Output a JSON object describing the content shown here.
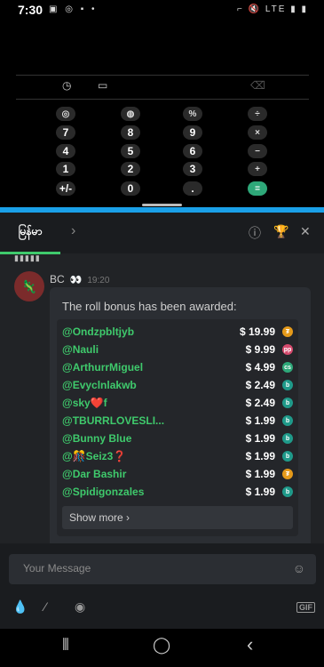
{
  "status": {
    "time": "7:30",
    "left_icons": "▣ ◎ ▪ •",
    "right_icons": "⌐ 🔇 LTE ▮ ▮"
  },
  "calculator": {
    "toolbar": {
      "history": "◷",
      "ruler": "▭",
      "backspace": "⌫"
    },
    "keys": [
      [
        "◎",
        "◍",
        "%",
        "÷"
      ],
      [
        "7",
        "8",
        "9",
        "×"
      ],
      [
        "4",
        "5",
        "6",
        "−"
      ],
      [
        "1",
        "2",
        "3",
        "+"
      ],
      [
        "+/-",
        "0",
        ".",
        "="
      ]
    ]
  },
  "app": {
    "tab_label": "မြန်မာ",
    "chevron": "›",
    "icons": {
      "info": "ⓘ",
      "trophy": "🏆",
      "close": "✕"
    },
    "preview_text": "▮▮▮▮▮",
    "message": {
      "author": "BC",
      "badge": "👀",
      "time": "19:20",
      "avatar": "🦎",
      "headline": "The roll bonus has been awarded:",
      "rows": [
        {
          "user": "@Ondzpbltjyb",
          "amount": "$ 19.99",
          "coin": "₮",
          "coin_color": "#e59a1a"
        },
        {
          "user": "@Nauli",
          "amount": "$ 9.99",
          "coin": "pp",
          "coin_color": "#d64a6d"
        },
        {
          "user": "@ArthurrMiguel",
          "amount": "$ 4.99",
          "coin": "cs",
          "coin_color": "#2ea879"
        },
        {
          "user": "@Evyclnlakwb",
          "amount": "$ 2.49",
          "coin": "b",
          "coin_color": "#1f9a8a"
        },
        {
          "user": "@sky❤️f",
          "amount": "$ 2.49",
          "coin": "b",
          "coin_color": "#1f9a8a"
        },
        {
          "user": "@TBURRLOVESLI...",
          "amount": "$ 1.99",
          "coin": "b",
          "coin_color": "#1f9a8a"
        },
        {
          "user": "@Bunny Blue",
          "amount": "$ 1.99",
          "coin": "b",
          "coin_color": "#1f9a8a"
        },
        {
          "user": "@🎊Seiz3❓",
          "amount": "$ 1.99",
          "coin": "b",
          "coin_color": "#1f9a8a"
        },
        {
          "user": "@Dar Bashir",
          "amount": "$ 1.99",
          "coin": "₮",
          "coin_color": "#e59a1a"
        },
        {
          "user": "@Spidigonzales",
          "amount": "$ 1.99",
          "coin": "b",
          "coin_color": "#1f9a8a"
        }
      ],
      "show_more": "Show more ›"
    },
    "input": {
      "placeholder": "Your Message",
      "emoji": "☺"
    },
    "tools": {
      "drop": "💧",
      "slash": "⁄",
      "coins": "◉",
      "gif": "GIF"
    }
  },
  "navbar": {
    "recents": "⦀",
    "home": "◯",
    "back": "‹"
  },
  "colors": {
    "accent": "#3fca6c",
    "topline": "#1aa0e8",
    "equals": "#2ea879"
  }
}
